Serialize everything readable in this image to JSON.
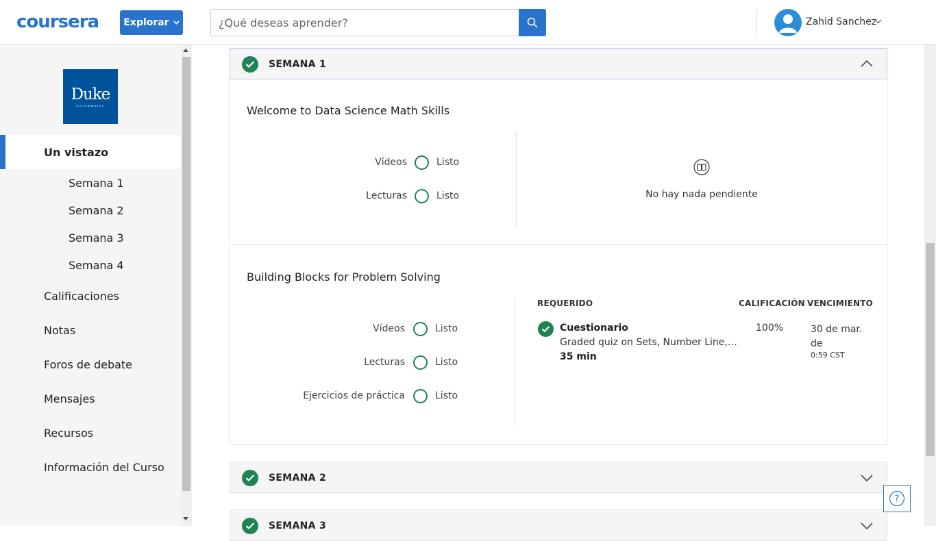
{
  "header": {
    "logo_text": "coursera",
    "explore_label": "Explorar",
    "search_placeholder": "¿Qué deseas aprender?",
    "user_name": "Zahid Sanchez"
  },
  "sidebar": {
    "university_logo": {
      "name": "Duke",
      "subtitle": "UNIVERSITY"
    },
    "active_item": "Un vistazo",
    "sub_items": [
      "Semana 1",
      "Semana 2",
      "Semana 3",
      "Semana 4"
    ],
    "items": [
      "Calificaciones",
      "Notas",
      "Foros de debate",
      "Mensajes",
      "Recursos",
      "Información del Curso"
    ]
  },
  "weeks": [
    {
      "title": "SEMANA 1",
      "expanded": true
    },
    {
      "title": "SEMANA 2",
      "expanded": false
    },
    {
      "title": "SEMANA 3",
      "expanded": false
    }
  ],
  "modules": [
    {
      "title": "Welcome to Data Science Math Skills",
      "progress": [
        {
          "label": "Vídeos",
          "status": "Listo"
        },
        {
          "label": "Lecturas",
          "status": "Listo"
        }
      ],
      "empty_text": "No hay nada pendiente"
    },
    {
      "title": "Building Blocks for Problem Solving",
      "progress": [
        {
          "label": "Vídeos",
          "status": "Listo"
        },
        {
          "label": "Lecturas",
          "status": "Listo"
        },
        {
          "label": "Ejercicios de práctica",
          "status": "Listo"
        }
      ],
      "table": {
        "headers": {
          "required": "REQUERIDO",
          "grade": "CALIFICACIÓN",
          "due": "VENCIMIENTO"
        },
        "item": {
          "type": "Cuestionario",
          "description": "Graded quiz on Sets, Number Line, Inequalities",
          "duration": "35 min",
          "grade": "100%",
          "due_date": "30 de mar. de",
          "due_time": "0:59 CST"
        }
      }
    }
  ],
  "colors": {
    "primary": "#2a73cc",
    "success": "#1f8354",
    "duke_blue": "#00539b"
  },
  "icons": [
    "search-icon",
    "chevron-down-icon",
    "chevron-up-icon",
    "check-icon",
    "book-icon",
    "help-icon",
    "avatar-icon"
  ]
}
